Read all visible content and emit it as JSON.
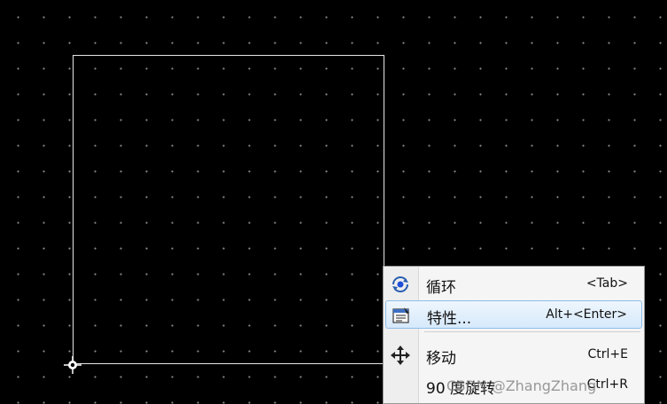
{
  "menu": {
    "items": [
      {
        "label": "循环",
        "shortcut": "<Tab>",
        "icon": "cycle-icon"
      },
      {
        "label": "特性...",
        "shortcut": "Alt+<Enter>",
        "icon": "properties-icon",
        "highlighted": true
      },
      {
        "label": "移动",
        "shortcut": "Ctrl+E",
        "icon": "move-icon"
      },
      {
        "label": "90 度旋转",
        "shortcut": "Ctrl+R",
        "icon": ""
      }
    ]
  },
  "watermark": "CSDN @ZhangZhang"
}
